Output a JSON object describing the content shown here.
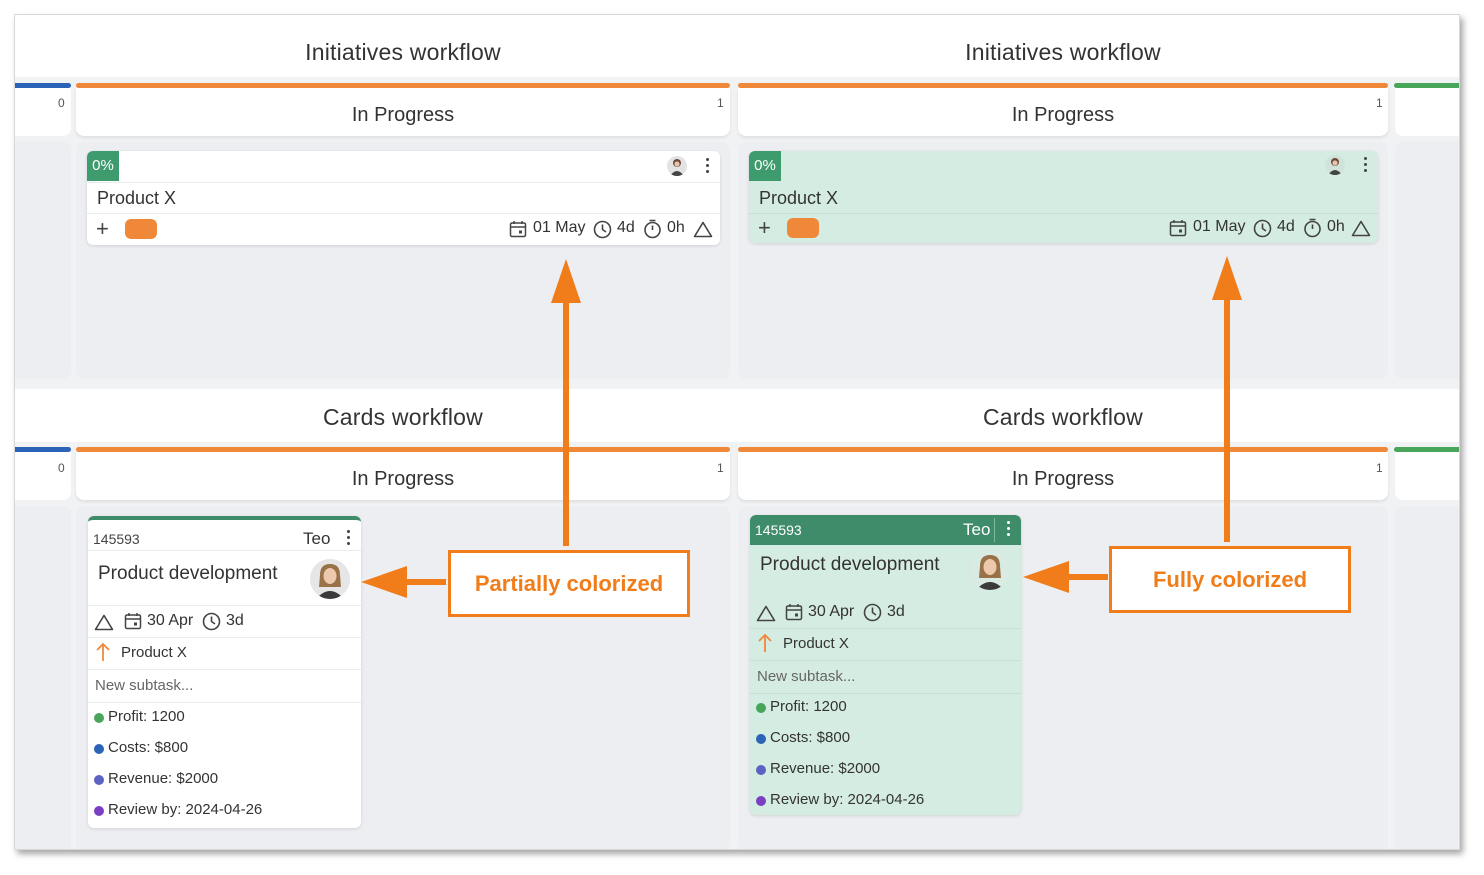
{
  "colors": {
    "orange": "#f0883a",
    "blue": "#2a63b8",
    "green": "#49a55a",
    "card_header_green": "#3e8c6a",
    "card_fill_green": "#d5ece2",
    "callout": "#f07d19"
  },
  "initiatives": {
    "title": "Initiatives workflow",
    "left_count": "0",
    "column": {
      "name": "In Progress",
      "count": "1"
    },
    "card": {
      "progress": "0%",
      "title": "Product X",
      "add_icon": "plus-icon",
      "date": "01 May",
      "duration": "4d",
      "time": "0h"
    }
  },
  "cards": {
    "title": "Cards workflow",
    "left_count": "0",
    "column": {
      "name": "In Progress",
      "count": "1"
    },
    "card": {
      "id": "145593",
      "owner": "Teo",
      "title": "Product development",
      "date": "30 Apr",
      "duration": "3d",
      "parent": "Product X",
      "subtask_placeholder": "New subtask...",
      "fields": [
        {
          "label": "Profit: 1200",
          "color": "#49a55a"
        },
        {
          "label": "Costs: $800",
          "color": "#2a63b8"
        },
        {
          "label": "Revenue: $2000",
          "color": "#5b62c4"
        },
        {
          "label": "Review by: 2024-04-26",
          "color": "#7b3fc4"
        }
      ]
    }
  },
  "callouts": {
    "partial": "Partially colorized",
    "full": "Fully colorized"
  }
}
